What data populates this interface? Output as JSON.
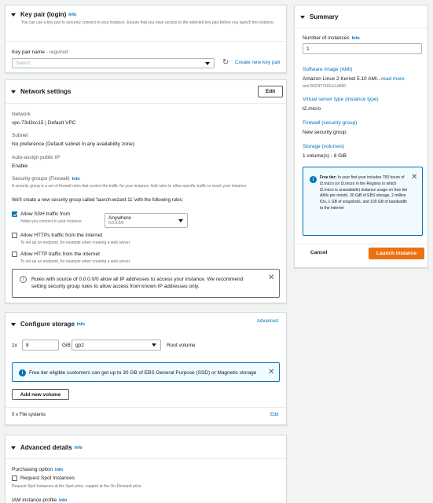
{
  "keypair": {
    "title": "Key pair (login)",
    "info": "Info",
    "desc": "You can use a key pair to securely connect to your instance. Ensure that you have access to the selected key pair before you launch the instance.",
    "name_label": "Key pair name",
    "name_required": " - required",
    "select_placeholder": "Select",
    "create_link": "Create new key pair"
  },
  "network": {
    "title": "Network settings",
    "edit_label": "Edit",
    "network_label": "Network",
    "network_value": "vpc-73d3cc15 | Default VPC",
    "subnet_label": "Subnet",
    "subnet_value": "No preference (Default subnet in any availability zone)",
    "publicip_label": "Auto-assign public IP",
    "publicip_value": "Enable",
    "sg_label": "Security groups (Firewall)",
    "sg_info": "Info",
    "sg_desc": "A security group is a set of firewall rules that control the traffic for your instance. Add rules to allow specific traffic to reach your instance.",
    "sg_create_text": "We'll create a new security group called 'launch-wizard-11' with the following rules:",
    "ssh_label": "Allow SSH traffic from",
    "ssh_desc": "Helps you connect to your instance",
    "ssh_source": "Anywhere",
    "ssh_source_sub": "0.0.0.0/0",
    "https_label": "Allow HTTPs traffic from the internet",
    "https_desc": "To set up an endpoint, for example when creating a web server",
    "http_label": "Allow HTTP traffic from the internet",
    "http_desc": "To set up an endpoint, for example when creating a web server",
    "warning": "Rules with source of 0.0.0.0/0 allow all IP addresses to access your instance. We recommend setting security group rules to allow access from known IP addresses only."
  },
  "storage": {
    "title": "Configure storage",
    "info": "Info",
    "advanced_link": "Advanced",
    "count_prefix": "1x",
    "size_value": "8",
    "unit": "GiB",
    "volume_type": "gp2",
    "root_label": "Root volume",
    "free_tier": "Free tier eligible customers can get up to 30 GB of EBS General Purpose (SSD) or Magnetic storage",
    "add_volume_label": "Add new volume",
    "filesystems": "0 x File systems",
    "edit_link": "Edit"
  },
  "advanced": {
    "title": "Advanced details",
    "info": "Info",
    "purchasing_label": "Purchasing option",
    "purchasing_info": "Info",
    "spot_label": "Request Spot Instances",
    "spot_desc": "Request Spot Instances at the Spot price, capped at the On-Demand price",
    "iam_label": "IAM instance profile",
    "iam_info": "Info"
  },
  "summary": {
    "title": "Summary",
    "instances_label": "Number of instances",
    "instances_info": "Info",
    "instances_value": "1",
    "ami_link": "Software Image (AMI)",
    "ami_value": "Amazon Linux 2 Kernel 5.10 AMI...",
    "ami_read_more": "read more",
    "ami_id": "ami-0022f774911c1d690",
    "type_link": "Virtual server type (instance type)",
    "type_value": "t2.micro",
    "firewall_link": "Firewall (security group)",
    "firewall_value": "New security group",
    "storage_link": "Storage (volumes)",
    "storage_value": "1 volume(s) - 8 GiB",
    "free_tier_bold": "Free tier:",
    "free_tier_text": " In your first year includes 750 hours of t2.micro (or t3.micro in the Regions in which t2.micro is unavailable) instance usage on free tier AMIs per month, 30 GiB of EBS storage, 2 million IOs, 1 GB of snapshots, and 100 GB of bandwidth to the internet",
    "cancel_label": "Cancel",
    "launch_label": "Launch instance"
  },
  "colors": {
    "accent": "#0073bb",
    "launch": "#ec7211"
  }
}
